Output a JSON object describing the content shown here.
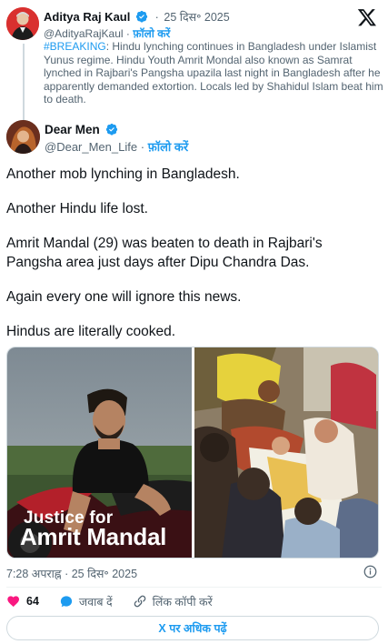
{
  "quoted_tweet": {
    "author_name": "Aditya Raj Kaul",
    "handle": "@AdityaRajKaul",
    "separator": "·",
    "follow_label": "फ़ॉलो करें",
    "timestamp": "25 दिस॰ 2025",
    "hashtag": "#BREAKING",
    "text": ": Hindu lynching continues in Bangladesh under Islamist Yunus regime. Hindu Youth Amrit Mondal also known as Samrat lynched in Rajbari's Pangsha upazila last night in Bangladesh after he apparently demanded extortion. Locals led by Shahidul Islam beat him to death."
  },
  "main_tweet": {
    "author_name": "Dear Men",
    "handle": "@Dear_Men_Life",
    "separator": "·",
    "follow_label": "फ़ॉलो करें",
    "paragraphs": [
      "Another mob lynching in Bangladesh.",
      "Another Hindu life lost.",
      "Amrit Mandal (29) was beaten to death in Rajbari's Pangsha area just days after Dipu Chandra Das.",
      "Again every one will ignore this news.",
      "Hindus are literally cooked."
    ],
    "media_caption_line1": "Justice for",
    "media_caption_line2": "Amrit Mandal",
    "time": "7:28 अपराह्न",
    "date": "25 दिस॰ 2025",
    "likes": "64",
    "reply_label": "जवाब दें",
    "copy_link_label": "लिंक कॉपी करें",
    "read_more_label": "X पर अधिक पढ़ें"
  },
  "colors": {
    "accent": "#1d9bf0",
    "like": "#f91880",
    "text_secondary": "#536471",
    "border": "#cfd9de"
  },
  "icons": [
    "x-logo-icon",
    "verified-badge-icon",
    "info-icon",
    "heart-icon",
    "reply-icon",
    "link-icon"
  ]
}
